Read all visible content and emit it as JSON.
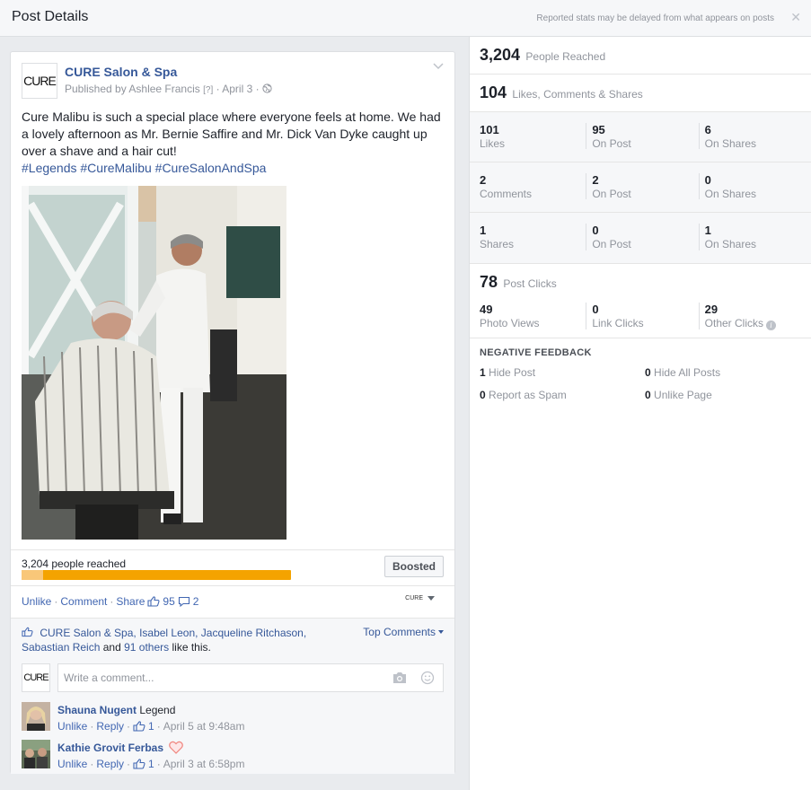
{
  "header": {
    "title": "Post Details",
    "note": "Reported stats may be delayed from what appears on posts",
    "close_glyph": "✕"
  },
  "post": {
    "page_logo_text": "CURE",
    "page_name": "CURE Salon & Spa",
    "published_by_prefix": "Published by",
    "publisher": "Ashlee Francis",
    "publisher_tag": "[?]",
    "date": "April 3",
    "text": "Cure Malibu is such a special place where everyone feels at home. We had a lovely afternoon as Mr. Bernie Saffire and Mr. Dick Van Dyke caught up over a shave and a hair cut!",
    "hashtags": "#Legends #CureMalibu #CureSalonAndSpa",
    "reach_text": "3,204 people reached",
    "organic_fraction": 0.08,
    "boosted_label": "Boosted",
    "actions": {
      "unlike": "Unlike",
      "comment": "Comment",
      "share": "Share",
      "like_count": "95",
      "comment_count": "2"
    },
    "page_switch_label": "CURE",
    "likes_names": "CURE Salon & Spa, Isabel Leon, Jacqueline Ritchason, Sabastian Reich",
    "likes_and": "and",
    "likes_others": "91 others",
    "likes_suffix": "like this.",
    "top_comments": "Top Comments",
    "composer_placeholder": "Write a comment...",
    "composer_logo_text": "CURE",
    "comments": [
      {
        "author": "Shauna Nugent",
        "text": "Legend",
        "unlike": "Unlike",
        "reply": "Reply",
        "likes": "1",
        "time": "April 5 at 9:48am"
      },
      {
        "author": "Kathie Grovit Ferbas",
        "text": "",
        "unlike": "Unlike",
        "reply": "Reply",
        "likes": "1",
        "time": "April 3 at 6:58pm"
      }
    ]
  },
  "stats": {
    "reached": {
      "value": "3,204",
      "label": "People Reached"
    },
    "engagement": {
      "value": "104",
      "label": "Likes, Comments & Shares"
    },
    "rows": [
      [
        {
          "value": "101",
          "label": "Likes"
        },
        {
          "value": "95",
          "label": "On Post"
        },
        {
          "value": "6",
          "label": "On Shares"
        }
      ],
      [
        {
          "value": "2",
          "label": "Comments"
        },
        {
          "value": "2",
          "label": "On Post"
        },
        {
          "value": "0",
          "label": "On Shares"
        }
      ],
      [
        {
          "value": "1",
          "label": "Shares"
        },
        {
          "value": "0",
          "label": "On Post"
        },
        {
          "value": "1",
          "label": "On Shares"
        }
      ]
    ],
    "clicks": {
      "value": "78",
      "label": "Post Clicks"
    },
    "click_breakdown": [
      {
        "value": "49",
        "label": "Photo Views"
      },
      {
        "value": "0",
        "label": "Link Clicks"
      },
      {
        "value": "29",
        "label": "Other Clicks"
      }
    ],
    "info_glyph": "i",
    "negative": {
      "title": "NEGATIVE FEEDBACK",
      "items": [
        {
          "value": "1",
          "label": "Hide Post"
        },
        {
          "value": "0",
          "label": "Hide All Posts"
        },
        {
          "value": "0",
          "label": "Report as Spam"
        },
        {
          "value": "0",
          "label": "Unlike Page"
        }
      ]
    }
  },
  "colors": {
    "link": "#4267b2",
    "name": "#365899",
    "reach_paid": "#f4a300",
    "reach_organic": "#f9c779",
    "background": "#e9ebee"
  }
}
